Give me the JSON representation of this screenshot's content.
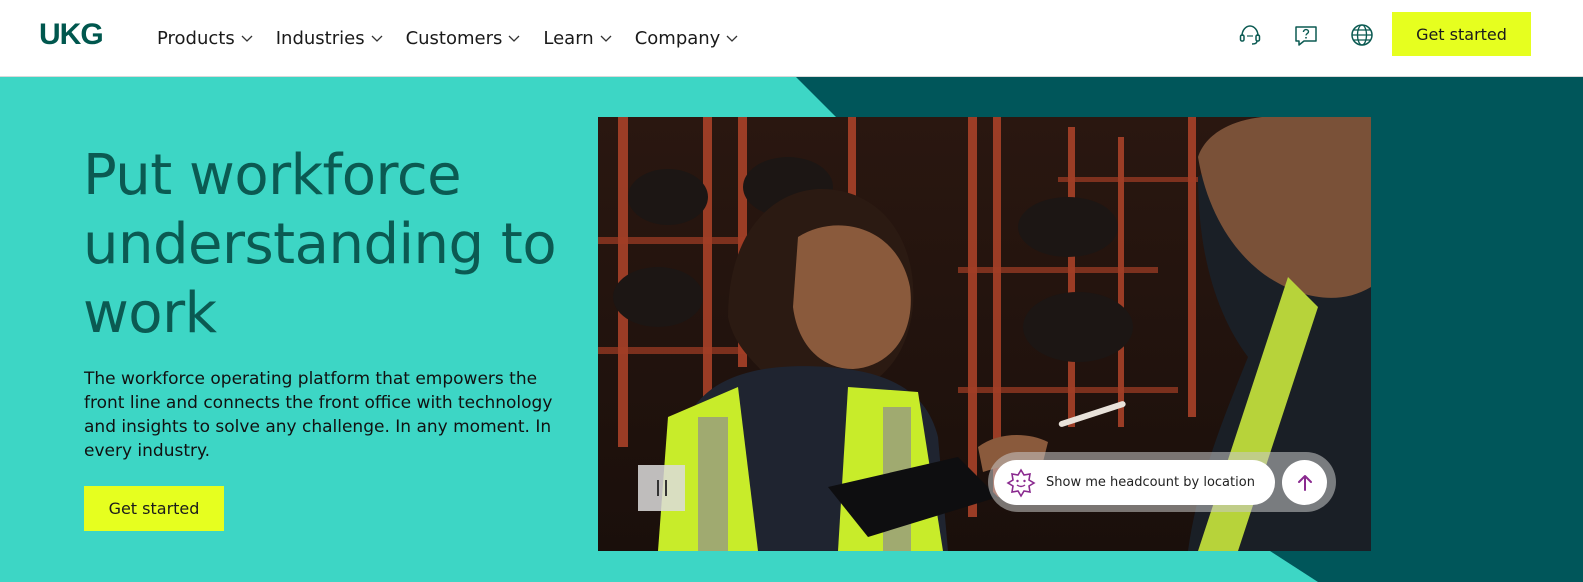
{
  "header": {
    "logo_text": "UKG",
    "nav": [
      {
        "label": "Products"
      },
      {
        "label": "Industries"
      },
      {
        "label": "Customers"
      },
      {
        "label": "Learn"
      },
      {
        "label": "Company"
      }
    ],
    "icons": [
      "support-agent-icon",
      "help-chat-icon",
      "globe-icon"
    ],
    "cta_label": "Get started"
  },
  "hero": {
    "headline": "Put workforce understanding to work",
    "subtext": "The workforce operating platform that empowers the front line and connects the front office with technology and insights to solve any challenge. In any moment. In every industry.",
    "cta_label": "Get started",
    "prompt_text": "Show me headcount by location"
  },
  "colors": {
    "brand_teal": "#3dd6c5",
    "brand_dark": "#00565a",
    "accent_yellow": "#e6ff1f",
    "text_dark_teal": "#0b5a52"
  }
}
